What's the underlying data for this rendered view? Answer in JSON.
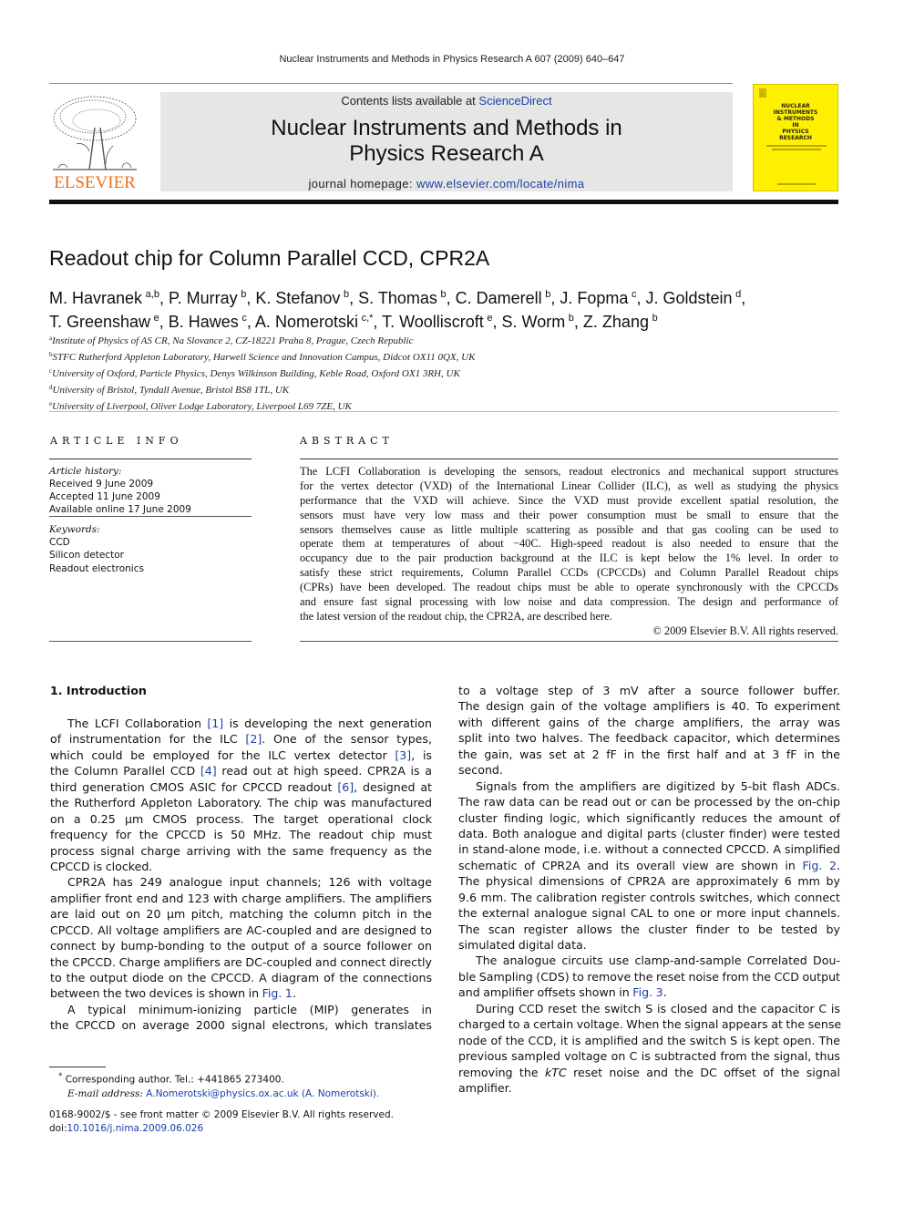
{
  "running_head": "Nuclear Instruments and Methods in Physics Research A 607 (2009) 640–647",
  "header": {
    "publisher_logo_text": "ELSEVIER",
    "contents_prefix": "Contents lists available at ",
    "contents_link": "ScienceDirect",
    "journal_title_line1": "Nuclear Instruments and Methods in",
    "journal_title_line2": "Physics Research A",
    "homepage_prefix": "journal homepage: ",
    "homepage_link": "www.elsevier.com/locate/nima",
    "cover_title_lines": [
      "NUCLEAR",
      "INSTRUMENTS",
      "& METHODS",
      "IN",
      "PHYSICS",
      "RESEARCH"
    ],
    "colors": {
      "elsevier_orange": "#e8711e",
      "cover_yellow": "#ffef00",
      "banner_gray": "#e6e6e6",
      "link_blue": "#1a3fa6"
    }
  },
  "article": {
    "title": "Readout chip for Column Parallel CCD, CPR2A",
    "authors_line1": [
      {
        "name": "M. Havranek",
        "sup": "a,b"
      },
      {
        "name": "P. Murray",
        "sup": "b"
      },
      {
        "name": "K. Stefanov",
        "sup": "b"
      },
      {
        "name": "S. Thomas",
        "sup": "b"
      },
      {
        "name": "C. Damerell",
        "sup": "b"
      },
      {
        "name": "J. Fopma",
        "sup": "c"
      },
      {
        "name": "J. Goldstein",
        "sup": "d"
      }
    ],
    "authors_line2": [
      {
        "name": "T. Greenshaw",
        "sup": "e"
      },
      {
        "name": "B. Hawes",
        "sup": "c"
      },
      {
        "name": "A. Nomerotski",
        "sup": "c,*"
      },
      {
        "name": "T. Woolliscroft",
        "sup": "e"
      },
      {
        "name": "S. Worm",
        "sup": "b"
      },
      {
        "name": "Z. Zhang",
        "sup": "b"
      }
    ],
    "affiliations": [
      {
        "key": "a",
        "text": "Institute of Physics of AS CR, Na Slovance 2, CZ-18221 Praha 8, Prague, Czech Republic"
      },
      {
        "key": "b",
        "text": "STFC Rutherford Appleton Laboratory, Harwell Science and Innovation Campus, Didcot OX11 0QX, UK"
      },
      {
        "key": "c",
        "text": "University of Oxford, Particle Physics, Denys Wilkinson Building, Keble Road, Oxford OX1 3RH, UK"
      },
      {
        "key": "d",
        "text": "University of Bristol, Tyndall Avenue, Bristol BS8 1TL, UK"
      },
      {
        "key": "e",
        "text": "University of Liverpool, Oliver Lodge Laboratory, Liverpool L69 7ZE, UK"
      }
    ]
  },
  "article_info": {
    "heading": "ARTICLE INFO",
    "history_label": "Article history:",
    "history": [
      "Received 9 June 2009",
      "Accepted 11 June 2009",
      "Available online 17 June 2009"
    ],
    "keywords_label": "Keywords:",
    "keywords": [
      "CCD",
      "Silicon detector",
      "Readout electronics"
    ]
  },
  "abstract": {
    "heading": "ABSTRACT",
    "lines": [
      "The LCFI Collaboration is developing the sensors, readout electronics and mechanical support structures",
      "for the vertex detector (VXD) of the International Linear Collider (ILC), as well as studying the physics",
      "performance that the VXD will achieve. Since the VXD must provide excellent spatial resolution, the",
      "sensors must have very low mass and their power consumption must be small to ensure that the",
      "sensors themselves cause as little multiple scattering as possible and that gas cooling can be used to",
      "operate them at temperatures of about −40C. High-speed readout is also needed to ensure that the",
      "occupancy due to the pair production background at the ILC is kept below the 1% level. In order to",
      "satisfy these strict requirements, Column Parallel CCDs (CPCCDs) and Column Parallel Readout chips",
      "(CPRs) have been developed. The readout chips must be able to operate synchronously with the CPCCDs",
      "and ensure fast signal processing with low noise and data compression. The design and performance of",
      "the latest version of the readout chip, the CPR2A, are described here."
    ],
    "copyright": "© 2009 Elsevier B.V. All rights reserved."
  },
  "body": {
    "section_heading": "1.  Introduction",
    "left_column": [
      {
        "indent": true,
        "last": false,
        "parts": [
          {
            "t": "The LCFI Collaboration "
          },
          {
            "t": "[1]",
            "link": true
          },
          {
            "t": " is developing the next generation"
          }
        ]
      },
      {
        "indent": false,
        "last": false,
        "parts": [
          {
            "t": "of instrumentation for the ILC "
          },
          {
            "t": "[2]",
            "link": true
          },
          {
            "t": ". One of the sensor types,"
          }
        ]
      },
      {
        "indent": false,
        "last": false,
        "parts": [
          {
            "t": "which could be employed for the ILC vertex detector "
          },
          {
            "t": "[3]",
            "link": true
          },
          {
            "t": ", is"
          }
        ]
      },
      {
        "indent": false,
        "last": false,
        "parts": [
          {
            "t": "the Column Parallel CCD "
          },
          {
            "t": "[4]",
            "link": true
          },
          {
            "t": " read out at high speed. CPR2A is a"
          }
        ]
      },
      {
        "indent": false,
        "last": false,
        "parts": [
          {
            "t": "third generation CMOS ASIC for CPCCD readout "
          },
          {
            "t": "[6]",
            "link": true
          },
          {
            "t": ", designed at"
          }
        ]
      },
      {
        "indent": false,
        "last": false,
        "parts": [
          {
            "t": "the Rutherford Appleton Laboratory. The chip was manufactured"
          }
        ]
      },
      {
        "indent": false,
        "last": false,
        "parts": [
          {
            "t": "on a 0.25 μm CMOS process. The target operational clock"
          }
        ]
      },
      {
        "indent": false,
        "last": false,
        "parts": [
          {
            "t": "frequency for the CPCCD is 50 MHz. The readout chip must"
          }
        ]
      },
      {
        "indent": false,
        "last": false,
        "parts": [
          {
            "t": "process signal charge arriving with the same frequency as the"
          }
        ]
      },
      {
        "indent": false,
        "last": true,
        "parts": [
          {
            "t": "CPCCD is clocked."
          }
        ]
      },
      {
        "indent": true,
        "last": false,
        "parts": [
          {
            "t": "CPR2A has 249 analogue input channels; 126 with voltage"
          }
        ]
      },
      {
        "indent": false,
        "last": false,
        "parts": [
          {
            "t": "amplifier front end and 123 with charge amplifiers. The amplifiers"
          }
        ]
      },
      {
        "indent": false,
        "last": false,
        "parts": [
          {
            "t": "are laid out on 20 μm pitch, matching the column pitch in the"
          }
        ]
      },
      {
        "indent": false,
        "last": false,
        "parts": [
          {
            "t": "CPCCD. All voltage amplifiers are AC-coupled and are designed to"
          }
        ]
      },
      {
        "indent": false,
        "last": false,
        "parts": [
          {
            "t": "connect by bump-bonding to the output of a source follower on"
          }
        ]
      },
      {
        "indent": false,
        "last": false,
        "parts": [
          {
            "t": "the CPCCD. Charge amplifiers are DC-coupled and connect directly"
          }
        ]
      },
      {
        "indent": false,
        "last": false,
        "parts": [
          {
            "t": "to the output diode on the CPCCD. A diagram of the connections"
          }
        ]
      },
      {
        "indent": false,
        "last": true,
        "parts": [
          {
            "t": "between the two devices is shown in "
          },
          {
            "t": "Fig. 1",
            "link": true
          },
          {
            "t": "."
          }
        ]
      },
      {
        "indent": true,
        "last": false,
        "parts": [
          {
            "t": "A typical minimum-ionizing particle (MIP) generates in"
          }
        ]
      },
      {
        "indent": false,
        "last": false,
        "parts": [
          {
            "t": "the CPCCD on average 2000 signal electrons, which translates"
          }
        ]
      }
    ],
    "right_column": [
      {
        "indent": false,
        "last": false,
        "parts": [
          {
            "t": "to a voltage step of 3 mV after a source follower buffer."
          }
        ]
      },
      {
        "indent": false,
        "last": false,
        "parts": [
          {
            "t": "The design gain of the voltage amplifiers is 40. To experiment"
          }
        ]
      },
      {
        "indent": false,
        "last": false,
        "parts": [
          {
            "t": "with different gains of the charge amplifiers, the array was"
          }
        ]
      },
      {
        "indent": false,
        "last": false,
        "parts": [
          {
            "t": "split into two halves. The feedback capacitor, which determines"
          }
        ]
      },
      {
        "indent": false,
        "last": false,
        "parts": [
          {
            "t": "the gain, was set at 2 fF in the first half and at 3 fF in the"
          }
        ]
      },
      {
        "indent": false,
        "last": true,
        "parts": [
          {
            "t": "second."
          }
        ]
      },
      {
        "indent": true,
        "last": false,
        "parts": [
          {
            "t": "Signals from the amplifiers are digitized by 5-bit flash ADCs."
          }
        ]
      },
      {
        "indent": false,
        "last": false,
        "parts": [
          {
            "t": "The raw data can be read out or can be processed by the on-chip"
          }
        ]
      },
      {
        "indent": false,
        "last": false,
        "parts": [
          {
            "t": "cluster finding logic, which significantly reduces the amount of"
          }
        ]
      },
      {
        "indent": false,
        "last": false,
        "parts": [
          {
            "t": "data. Both analogue and digital parts (cluster finder) were tested"
          }
        ]
      },
      {
        "indent": false,
        "last": false,
        "parts": [
          {
            "t": "in stand-alone mode, i.e. without a connected CPCCD. A simplified"
          }
        ]
      },
      {
        "indent": false,
        "last": false,
        "parts": [
          {
            "t": "schematic of CPR2A and its overall view are shown in "
          },
          {
            "t": "Fig. 2",
            "link": true
          },
          {
            "t": "."
          }
        ]
      },
      {
        "indent": false,
        "last": false,
        "parts": [
          {
            "t": "The physical dimensions of CPR2A are approximately 6 mm by"
          }
        ]
      },
      {
        "indent": false,
        "last": false,
        "parts": [
          {
            "t": "9.6 mm. The calibration register controls switches, which connect"
          }
        ]
      },
      {
        "indent": false,
        "last": false,
        "parts": [
          {
            "t": "the external analogue signal CAL to one or more input channels."
          }
        ]
      },
      {
        "indent": false,
        "last": false,
        "parts": [
          {
            "t": "The scan register allows the cluster finder to be tested by"
          }
        ]
      },
      {
        "indent": false,
        "last": true,
        "parts": [
          {
            "t": "simulated digital data."
          }
        ]
      },
      {
        "indent": true,
        "last": false,
        "parts": [
          {
            "t": "The analogue circuits use clamp-and-sample Correlated Dou-"
          }
        ]
      },
      {
        "indent": false,
        "last": false,
        "parts": [
          {
            "t": "ble Sampling (CDS) to remove the reset noise from the CCD output"
          }
        ]
      },
      {
        "indent": false,
        "last": true,
        "parts": [
          {
            "t": "and amplifier offsets shown in "
          },
          {
            "t": "Fig. 3",
            "link": true
          },
          {
            "t": "."
          }
        ]
      },
      {
        "indent": true,
        "last": false,
        "parts": [
          {
            "t": "During CCD reset the switch S is closed and the capacitor C is"
          }
        ]
      },
      {
        "indent": false,
        "last": false,
        "parts": [
          {
            "t": "charged to a certain voltage. When the signal appears at the sense"
          }
        ]
      },
      {
        "indent": false,
        "last": false,
        "parts": [
          {
            "t": "node of the CCD, it is amplified and the switch S is kept open. The"
          }
        ]
      },
      {
        "indent": false,
        "last": false,
        "parts": [
          {
            "t": "previous sampled voltage on C is subtracted from the signal, thus"
          }
        ]
      },
      {
        "indent": false,
        "last": false,
        "parts": [
          {
            "t": "removing the "
          },
          {
            "t": "kTC",
            "italic": true
          },
          {
            "t": " reset noise and the DC offset of the signal"
          }
        ]
      },
      {
        "indent": false,
        "last": true,
        "parts": [
          {
            "t": "amplifier."
          }
        ]
      }
    ]
  },
  "footnote": {
    "marker": "*",
    "corresponding": " Corresponding author. Tel.: +441865 273400.",
    "email_label": "E-mail address:",
    "email": "A.Nomerotski@physics.ox.ac.uk",
    "email_suffix": " (A. Nomerotski)."
  },
  "front_matter": {
    "issn_line": "0168-9002/$ - see front matter © 2009 Elsevier B.V. All rights reserved.",
    "doi_prefix": "doi:",
    "doi": "10.1016/j.nima.2009.06.026"
  }
}
